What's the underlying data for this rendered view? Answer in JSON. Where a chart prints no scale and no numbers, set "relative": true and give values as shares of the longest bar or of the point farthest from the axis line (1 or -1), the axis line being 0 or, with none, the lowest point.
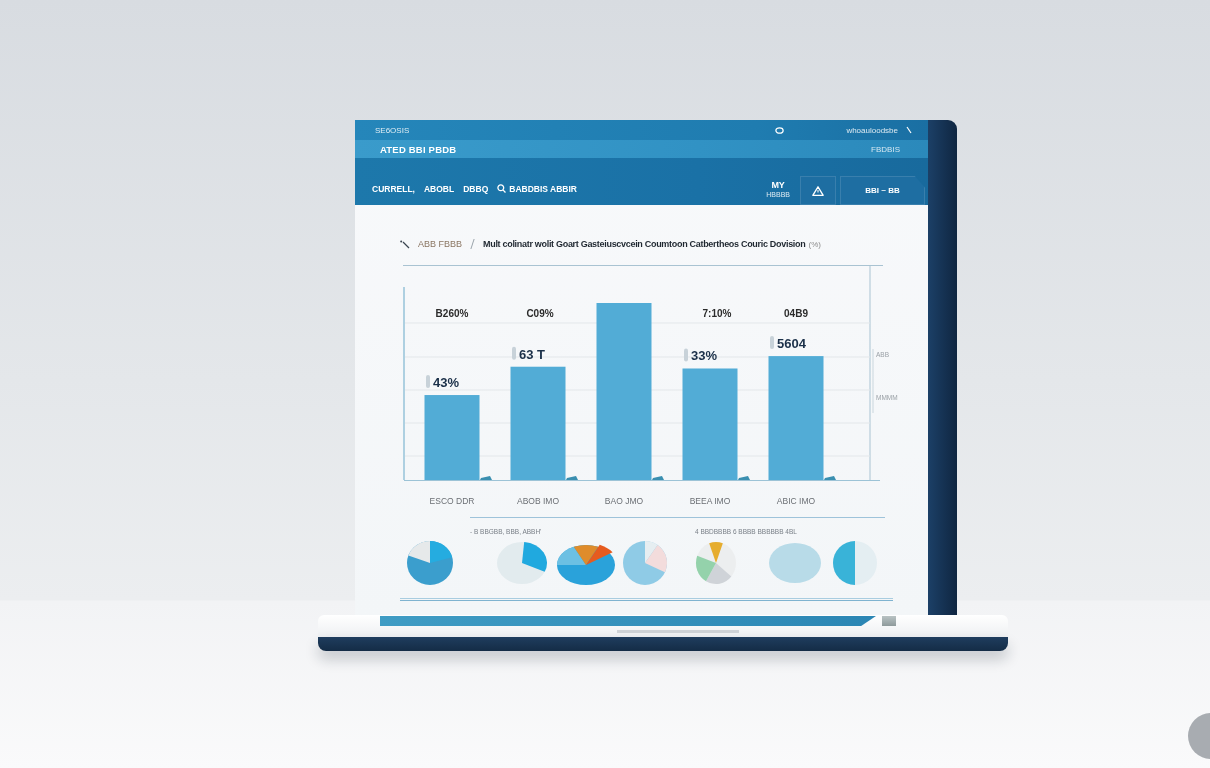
{
  "header": {
    "app_name": "SE6OSIS",
    "account": "whoauloodsbe",
    "page_title": "ATED BBI PBDB",
    "page_meta": "FBDBIS"
  },
  "toolbar": {
    "menu": [
      "CURRELL,",
      "ABOBL",
      "DBBQ"
    ],
    "search": {
      "label": "BABDBIS ABBIR"
    },
    "actions": [
      {
        "kind": "badge",
        "label": "MY",
        "caption": "HBBBB"
      },
      {
        "kind": "alert"
      },
      {
        "kind": "text",
        "label": "BBI ~ BB"
      }
    ]
  },
  "report": {
    "breadcrumb": "ABB FBBB",
    "unit": "(%)",
    "side_labels": [
      "ABB",
      "MMMM"
    ],
    "chart_data": {
      "type": "bar",
      "title": "Mult colinatr wolit Goart Gasteiuscvcein Coumtoon Catbertheos Couric Dovision",
      "relative": true,
      "categories": [
        "ESCO DDR",
        "ABOB IMO",
        "BAO JMO",
        "BEEA IMO",
        "ABIC IMO"
      ],
      "series": [
        {
          "values": [
            0.48,
            0.64,
            1,
            0.63,
            0.7
          ]
        }
      ],
      "annotations": [
        "B260%",
        "C09%",
        "7:10%",
        "04B9",
        {
          "x": "ESCO DDR",
          "y": 0.48,
          "text": "43%"
        },
        {
          "x": "ABOB IMO",
          "y": 0.64,
          "text": "63 T"
        },
        {
          "x": "BEEA IMO",
          "y": 0.63,
          "text": "33%"
        },
        {
          "x": "ABIC IMO",
          "y": 0.7,
          "text": "5604"
        }
      ]
    }
  },
  "pie_row": {
    "captions": [
      "- B BBGBB, BBB, ABBH'",
      "4 BBDBBBB 6 BBBB BBBBBB 4BL"
    ]
  }
}
